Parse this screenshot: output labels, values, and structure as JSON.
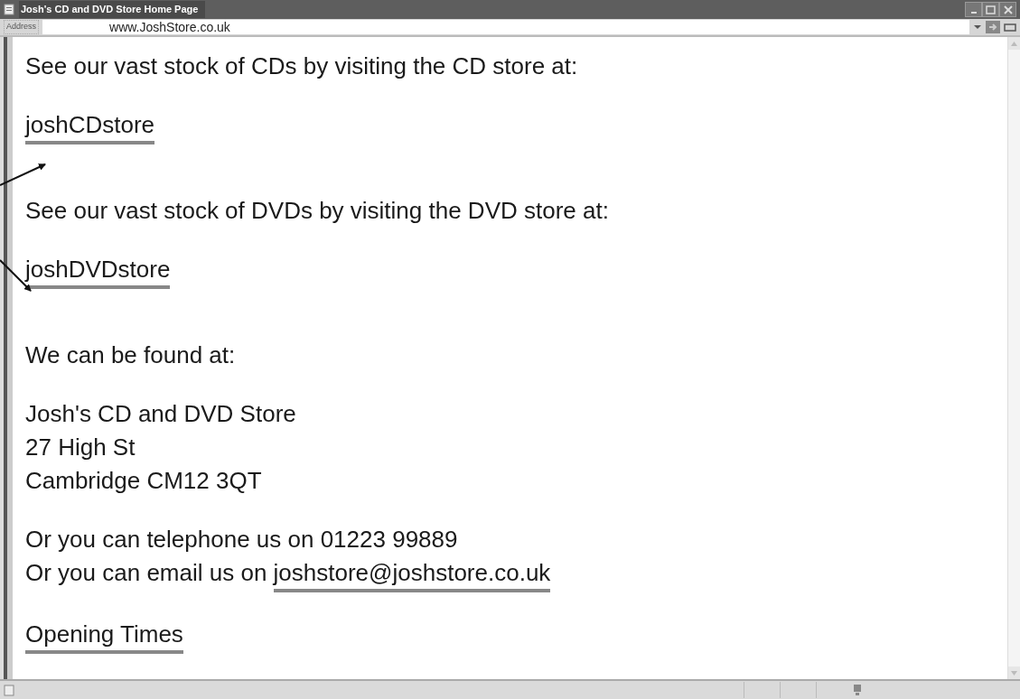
{
  "window": {
    "title": "Josh's CD and DVD Store Home Page"
  },
  "address_bar": {
    "label": "Address",
    "value": "www.JoshStore.co.uk"
  },
  "blocks": [
    {
      "lines": [
        {
          "text": "See our vast stock of CDs by visiting the CD store at:"
        }
      ]
    },
    {
      "lines": [
        {
          "link": "joshCDstore"
        }
      ]
    },
    {
      "lines": [
        {
          "text": "See our vast stock of DVDs by visiting the DVD store at:"
        }
      ]
    },
    {
      "lines": [
        {
          "link": "joshDVDstore"
        }
      ]
    },
    {
      "lines": [
        {
          "text": "We can be found at:"
        }
      ]
    },
    {
      "lines": [
        {
          "text": "Josh's CD and DVD Store"
        },
        {
          "text": "27 High St"
        },
        {
          "text": "Cambridge CM12 3QT"
        }
      ]
    },
    {
      "lines": [
        {
          "text": "Or you can telephone us on 01223 99889"
        },
        {
          "text": "Or you can email us on",
          "link": "joshstore@joshstore.co.uk"
        }
      ]
    },
    {
      "lines": [
        {
          "link": "Opening Times"
        }
      ]
    }
  ]
}
